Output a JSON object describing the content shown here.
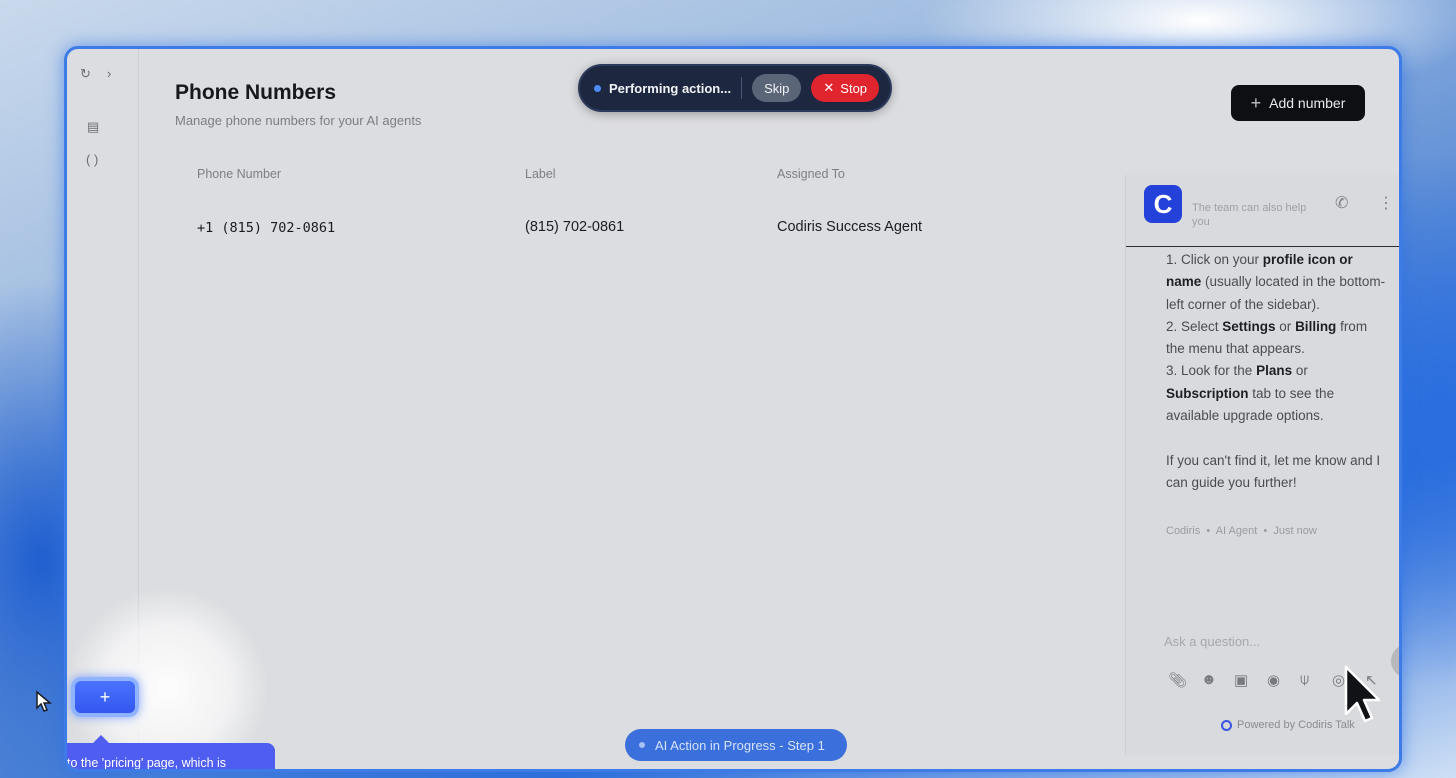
{
  "header": {
    "title": "Phone Numbers",
    "subtitle": "Manage phone numbers for your AI agents",
    "add_button_label": "Add number"
  },
  "automation_bar": {
    "status": "Performing action...",
    "skip_label": "Skip",
    "stop_label": "Stop"
  },
  "table": {
    "columns": [
      "Phone Number",
      "Label",
      "Assigned To"
    ],
    "rows": [
      {
        "phone": "+1 (815) 702-0861",
        "label": "(815) 702-0861",
        "assigned_to": "Codiris Success Agent"
      }
    ]
  },
  "chat": {
    "logo_letter": "C",
    "help_text": "The team can also help you",
    "message": {
      "line1_prefix": "1. Click on your ",
      "line1_bold": "profile icon or name",
      "line1_suffix": " (usually located in the bottom-left corner of the sidebar).",
      "line2_prefix": "2. Select ",
      "line2_bold1": "Settings",
      "line2_mid": " or ",
      "line2_bold2": "Billing",
      "line2_suffix": " from the menu that appears.",
      "line3_prefix": "3. Look for the ",
      "line3_bold1": "Plans",
      "line3_mid": " or ",
      "line3_bold2": "Subscription",
      "line3_suffix": " tab to see the available upgrade options.",
      "closing": "If you can't find it, let me know and I can guide you further!"
    },
    "meta": {
      "sender": "Codiris",
      "role": "AI Agent",
      "time": "Just now"
    },
    "input_placeholder": "Ask a question...",
    "powered_by": "Powered by Codiris Talk"
  },
  "progress_badge": "AI Action in Progress - Step 1",
  "tooltip_text": "to the 'pricing' page, which is",
  "colors": {
    "accent": "#3357f0",
    "stop": "#e0252e",
    "pill_bg": "#1d2840"
  }
}
